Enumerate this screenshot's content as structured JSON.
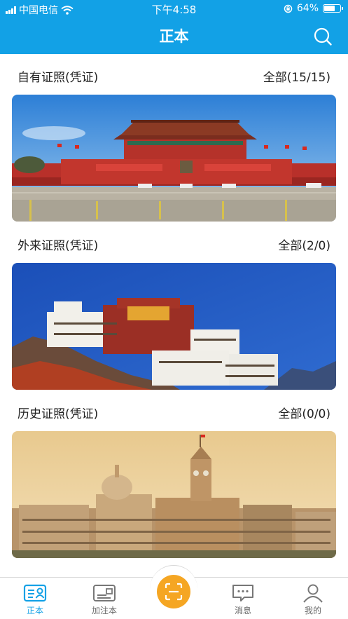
{
  "status_bar": {
    "carrier": "中国电信",
    "time": "下午4:58",
    "battery_percent": "64%",
    "battery_level": 0.64
  },
  "nav": {
    "title": "正本",
    "search_icon": "search-icon"
  },
  "sections": [
    {
      "label": "自有证照(凭证)",
      "count": "全部(15/15)",
      "image": "tiananmen-photo"
    },
    {
      "label": "外来证照(凭证)",
      "count": "全部(2/0)",
      "image": "potala-palace-photo"
    },
    {
      "label": "历史证照(凭证)",
      "count": "全部(0/0)",
      "image": "shanghai-bund-photo"
    }
  ],
  "tabbar": {
    "items": [
      {
        "label": "正本",
        "icon": "id-card-icon",
        "active": true
      },
      {
        "label": "加注本",
        "icon": "card-icon",
        "active": false
      },
      {
        "label": "消息",
        "icon": "message-icon",
        "active": false
      },
      {
        "label": "我的",
        "icon": "user-icon",
        "active": false
      }
    ],
    "scan_icon": "scan-icon"
  },
  "colors": {
    "primary": "#12a1e6",
    "scan_button": "#f5a623"
  }
}
